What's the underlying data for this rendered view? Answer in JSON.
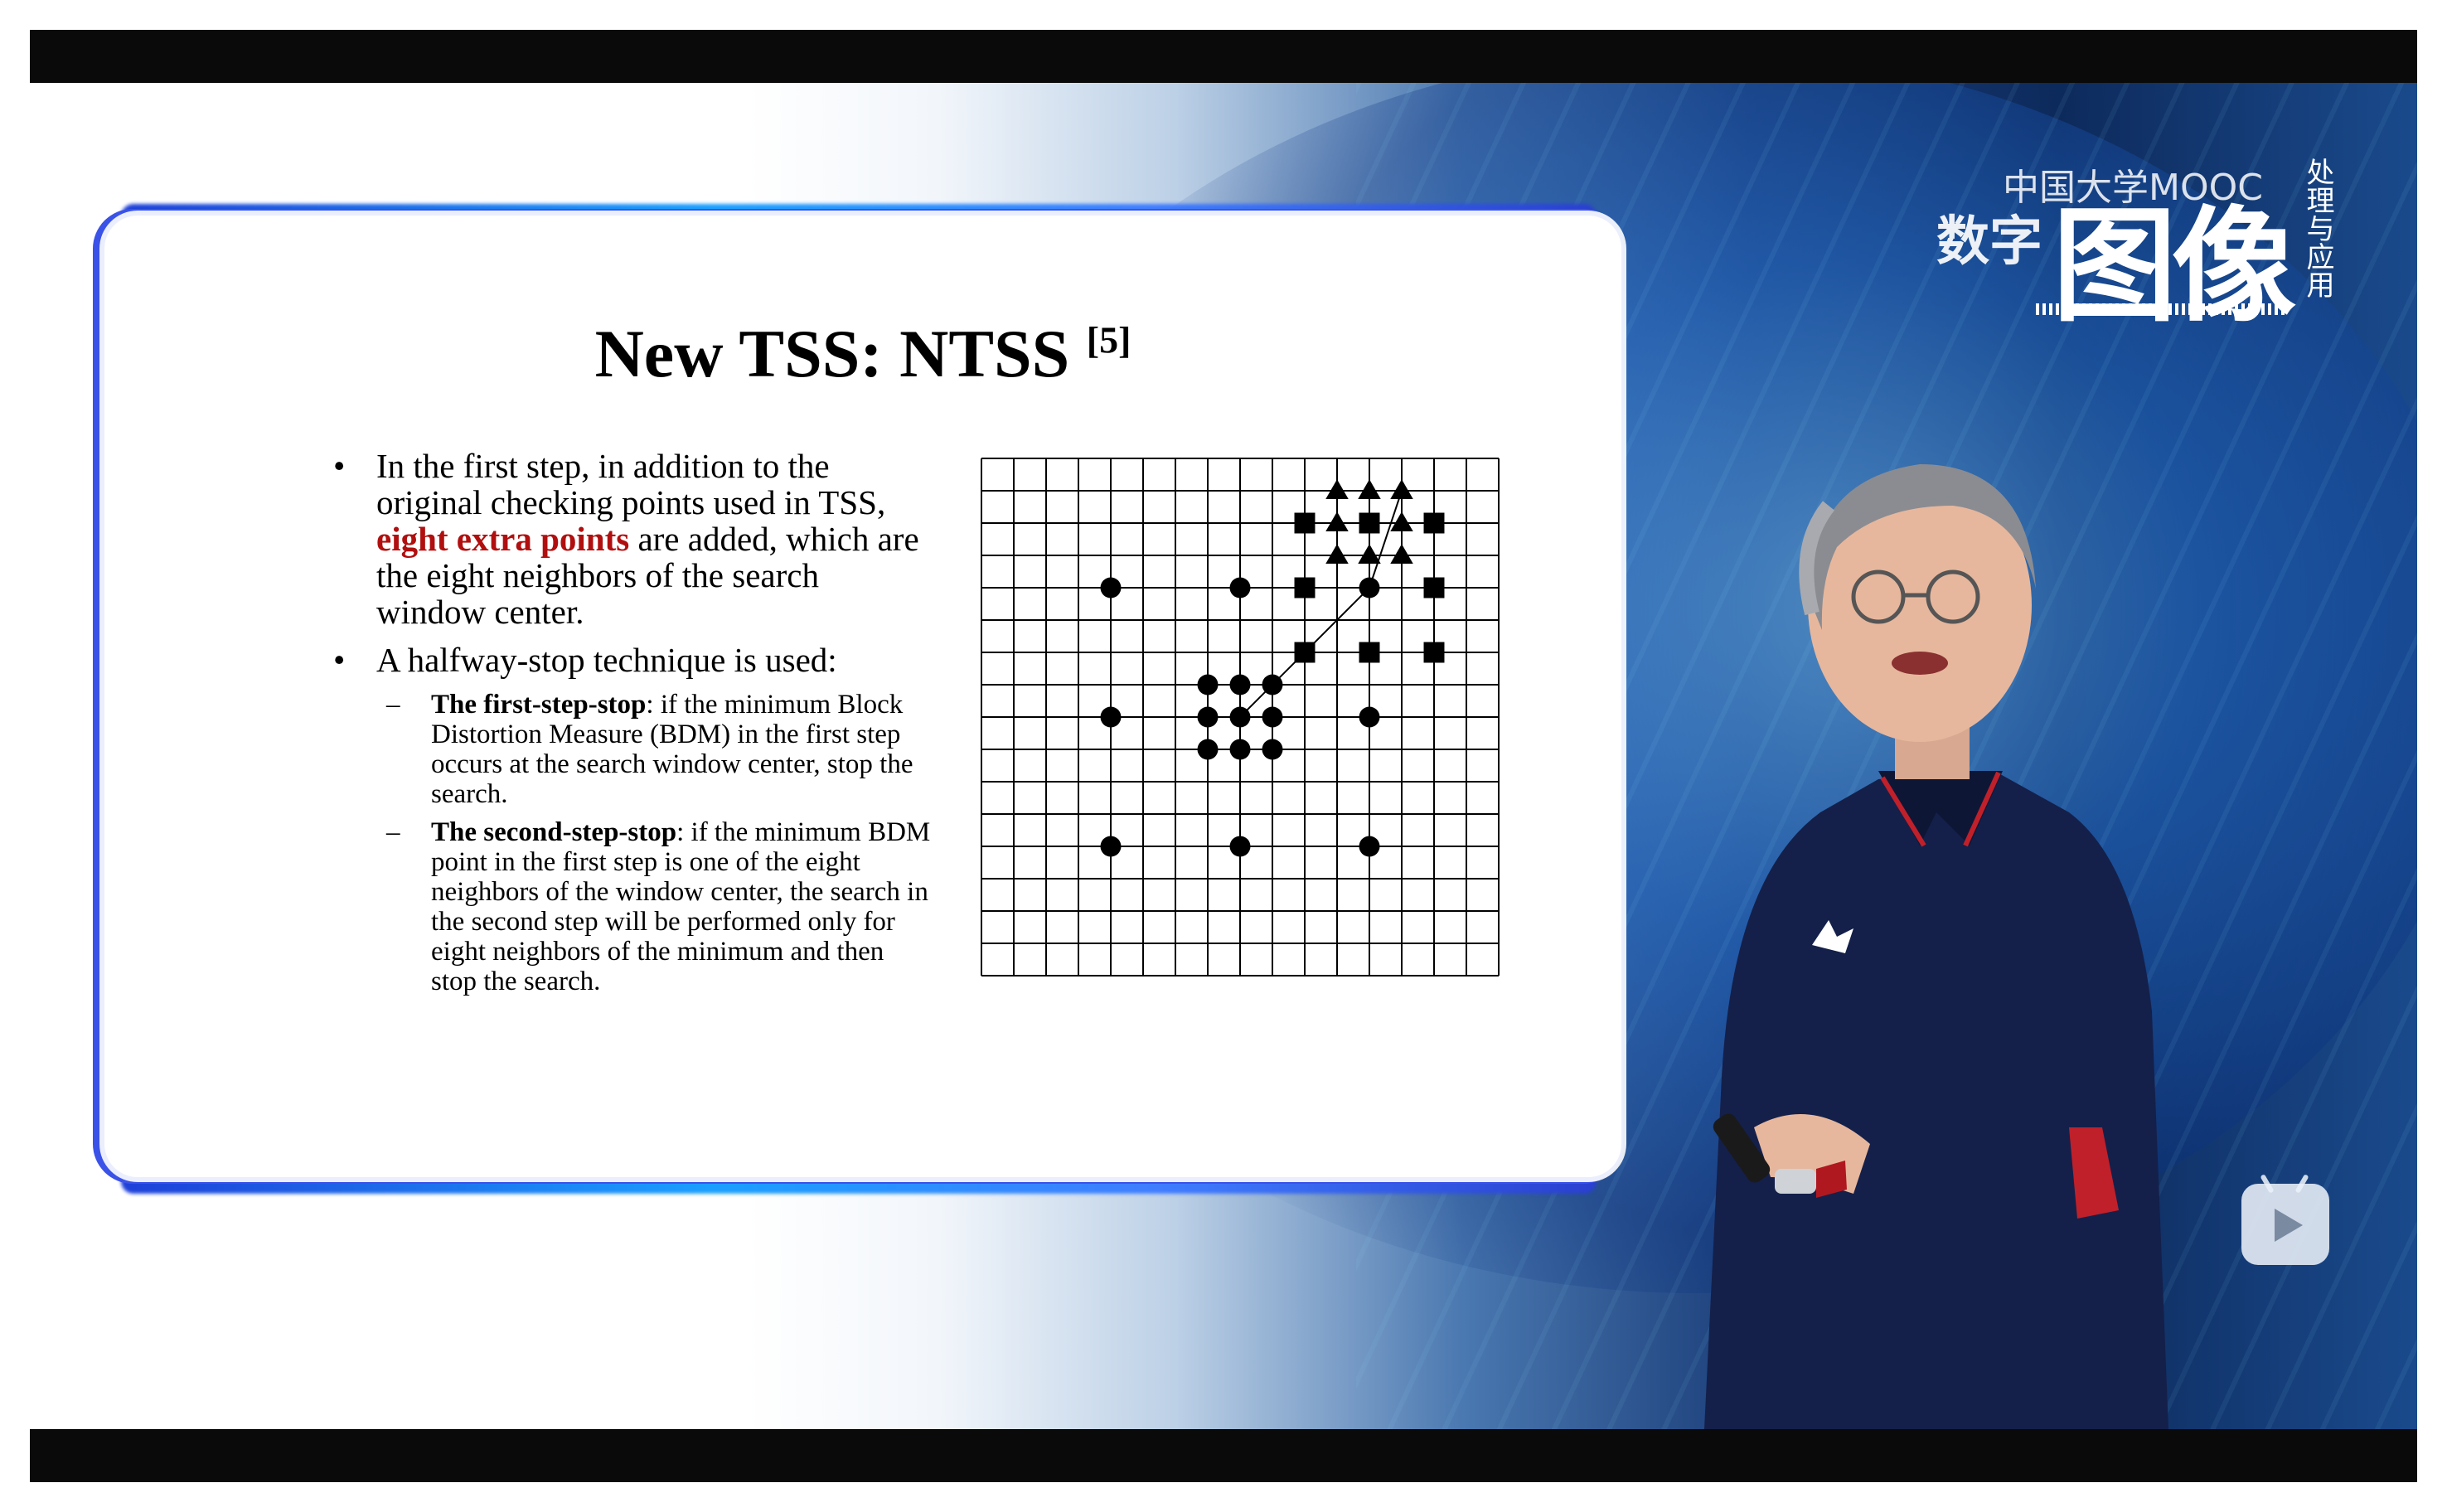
{
  "logo": {
    "left_text": "数字",
    "main_text": "图像",
    "mooc_text": "中国大学MOOC",
    "vertical_text": "处理与应用"
  },
  "slide": {
    "title": "New TSS: NTSS",
    "title_ref": "[5]",
    "bullet1_prefix": "In the first step, in addition to the original checking points used in TSS,",
    "bullet1_highlight": "eight extra points",
    "bullet1_suffix": "are added, which are the eight neighbors of the search window center.",
    "bullet2": "A halfway-stop technique is used:",
    "sub1_title": "The first-step-stop",
    "sub1_text": ": if the minimum Block Distortion Measure (BDM) in the first step occurs at the search window center, stop the search.",
    "sub2_title": "The second-step-stop",
    "sub2_text": ": if the minimum BDM point in the first step is one of the eight neighbors of the window center, the search in the second step will be performed only for eight neighbors of the minimum and then stop the search."
  },
  "colors": {
    "highlight": "#b10f0f",
    "glow": "#1a9fff",
    "frame": "#0a0a0a"
  },
  "diagram": {
    "grid_size": 16,
    "circles": [
      [
        4,
        4
      ],
      [
        8,
        4
      ],
      [
        12,
        4
      ],
      [
        4,
        8
      ],
      [
        12,
        8
      ],
      [
        4,
        12
      ],
      [
        8,
        12
      ],
      [
        12,
        12
      ],
      [
        7,
        7
      ],
      [
        8,
        7
      ],
      [
        9,
        7
      ],
      [
        7,
        8
      ],
      [
        8,
        8
      ],
      [
        9,
        8
      ],
      [
        7,
        9
      ],
      [
        8,
        9
      ],
      [
        9,
        9
      ]
    ],
    "squares": [
      [
        10,
        2
      ],
      [
        12,
        2
      ],
      [
        14,
        2
      ],
      [
        10,
        4
      ],
      [
        14,
        4
      ],
      [
        10,
        6
      ],
      [
        12,
        6
      ],
      [
        14,
        6
      ]
    ],
    "triangles": [
      [
        11,
        1
      ],
      [
        12,
        1
      ],
      [
        13,
        1
      ],
      [
        11,
        2
      ],
      [
        13,
        2
      ],
      [
        11,
        3
      ],
      [
        12,
        3
      ],
      [
        13,
        3
      ]
    ],
    "arrows": [
      [
        [
          8,
          8
        ],
        [
          12,
          4
        ]
      ],
      [
        [
          12,
          4
        ],
        [
          13,
          1
        ]
      ]
    ]
  },
  "icons": {
    "play": "bilibili-play-icon"
  }
}
